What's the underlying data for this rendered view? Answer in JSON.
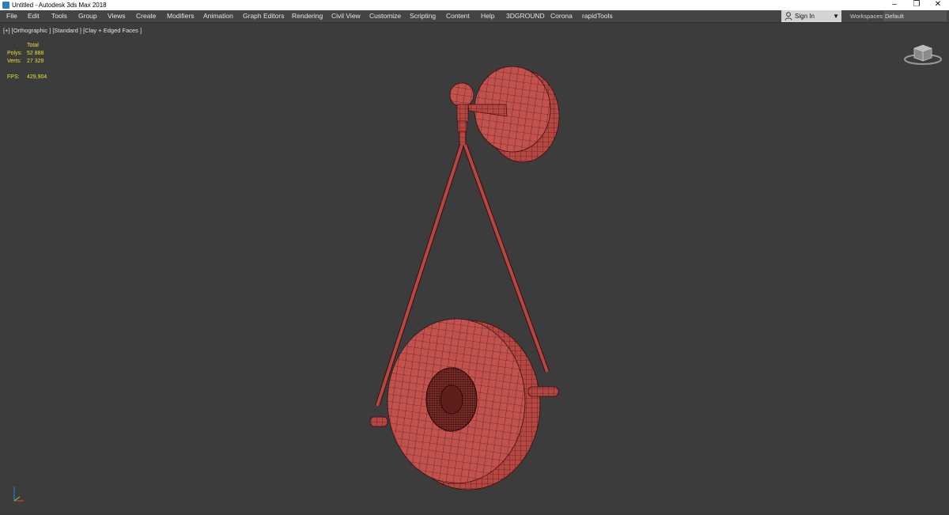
{
  "window": {
    "title": "Untitled - Autodesk 3ds Max 2018",
    "app_icon": "3dsmax-icon",
    "controls": {
      "minimize": "–",
      "restore": "❐",
      "close": "✕"
    }
  },
  "menu": {
    "items": [
      "File",
      "Edit",
      "Tools",
      "Group",
      "Views",
      "Create",
      "Modifiers",
      "Animation",
      "Graph Editors",
      "Rendering",
      "Civil View",
      "Customize",
      "Scripting",
      "Content",
      "Help",
      "3DGROUND",
      "Corona",
      "rapidTools"
    ],
    "sign_in": "Sign In",
    "workspaces_label": "Workspaces:",
    "workspace_value": "Default"
  },
  "viewport": {
    "label": "[+] [Orthographic ] [Standard ] [Clay + Edged Faces ]",
    "stats": {
      "header": "Total",
      "polys_label": "Polys:",
      "polys_value": "52 888",
      "verts_label": "Verts:",
      "verts_value": "27 329",
      "fps_label": "FPS:",
      "fps_value": "429,904"
    },
    "colors": {
      "background": "#3c3c3c",
      "clay": "#c0514e",
      "edges": "#3a0d0d",
      "stats_text": "#e8e030"
    }
  }
}
